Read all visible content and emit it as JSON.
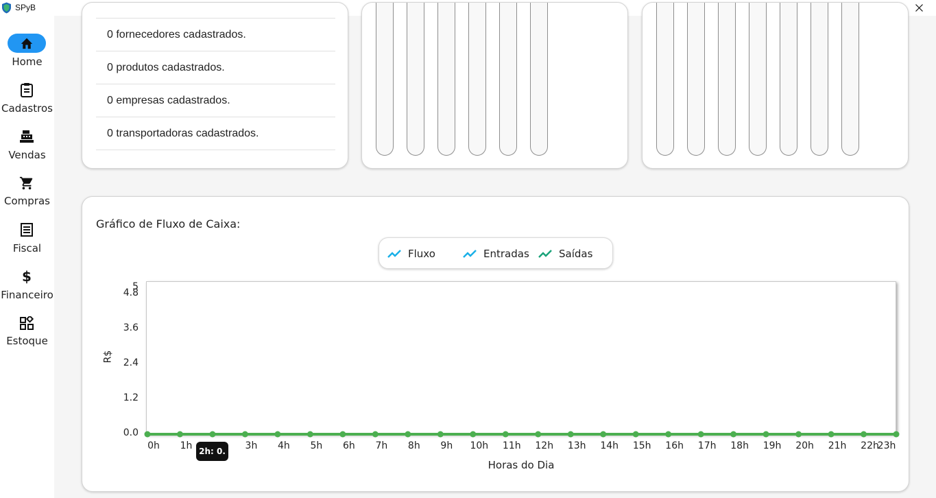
{
  "window": {
    "title": "SPyB"
  },
  "sidebar": {
    "items": [
      {
        "label": "Home",
        "icon": "home-icon",
        "active": true
      },
      {
        "label": "Cadastros",
        "icon": "clipboard-icon",
        "active": false
      },
      {
        "label": "Vendas",
        "icon": "point-of-sale-icon",
        "active": false
      },
      {
        "label": "Compras",
        "icon": "shopping-cart-icon",
        "active": false
      },
      {
        "label": "Fiscal",
        "icon": "receipt-icon",
        "active": false
      },
      {
        "label": "Financeiro",
        "icon": "dollar-icon",
        "active": false
      },
      {
        "label": "Estoque",
        "icon": "widgets-icon",
        "active": false
      }
    ]
  },
  "stats": [
    "0 fornecedores cadastrados.",
    "0 produtos cadastrados.",
    "0 empresas cadastrados.",
    "0 transportadoras cadastrados."
  ],
  "cashflow": {
    "title": "Gráfico de Fluxo de Caixa:",
    "legend": [
      "Fluxo",
      "Entradas",
      "Saídas"
    ],
    "tooltip": "2h: 0."
  },
  "colors": {
    "accent": "#2196f3",
    "legend_fluxo": "#1ab0e8",
    "legend_entradas": "#1ab0e8",
    "legend_saidas": "#1aa37a",
    "series_line": "#4caf50"
  },
  "chart_data": {
    "type": "line",
    "title": "",
    "xlabel": "Horas do Dia",
    "ylabel": "R$",
    "x": [
      "0h",
      "1h",
      "2h",
      "3h",
      "4h",
      "5h",
      "6h",
      "7h",
      "8h",
      "9h",
      "10h",
      "11h",
      "12h",
      "13h",
      "14h",
      "15h",
      "16h",
      "17h",
      "18h",
      "19h",
      "20h",
      "21h",
      "22h",
      "23h"
    ],
    "y_ticks": [
      "0.0",
      "1.2",
      "2.4",
      "3.6",
      "4.8",
      "5"
    ],
    "ylim": [
      0,
      5
    ],
    "series": [
      {
        "values": [
          0,
          0,
          0,
          0,
          0,
          0,
          0,
          0,
          0,
          0,
          0,
          0,
          0,
          0,
          0,
          0,
          0,
          0,
          0,
          0,
          0,
          0,
          0,
          0
        ]
      }
    ]
  }
}
